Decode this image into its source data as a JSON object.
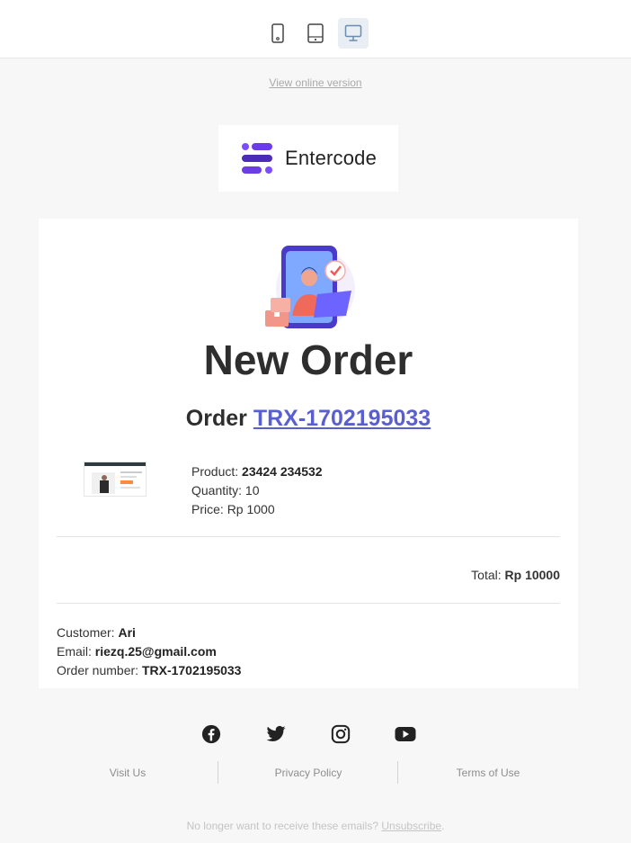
{
  "toolbar": {
    "devices": [
      {
        "name": "mobile",
        "icon": "mobile-icon",
        "active": false
      },
      {
        "name": "tablet",
        "icon": "tablet-icon",
        "active": false
      },
      {
        "name": "desktop",
        "icon": "desktop-icon",
        "active": true
      }
    ]
  },
  "header": {
    "view_online": "View online version",
    "logo_text": "Entercode",
    "logo_icon": "entercode-logo-icon"
  },
  "order": {
    "title": "New Order",
    "prefix": "Order",
    "number_link": "TRX-1702195033",
    "product_label": "Product:",
    "product_value": "23424 234532",
    "quantity_label": "Quantity:",
    "quantity_value": "10",
    "price_label": "Price:",
    "price_value": "Rp 1000",
    "total_label": "Total:",
    "total_value": "Rp 10000"
  },
  "customer": {
    "name_label": "Customer:",
    "name_value": "Ari",
    "email_label": "Email:",
    "email_value": "riezq.25@gmail.com",
    "order_number_label": "Order number:",
    "order_number_value": "TRX-1702195033"
  },
  "footer": {
    "social": [
      "facebook-icon",
      "twitter-icon",
      "instagram-icon",
      "youtube-icon"
    ],
    "links": [
      "Visit Us",
      "Privacy Policy",
      "Terms of Use"
    ],
    "unsub_text": "No longer want to receive these emails?",
    "unsub_link": "Unsubscribe",
    "unsub_suffix": "."
  },
  "colors": {
    "accent": "#5a5fd0",
    "logo_purple": "#6c3ce9",
    "selected_device_bg": "#e8eef4"
  }
}
